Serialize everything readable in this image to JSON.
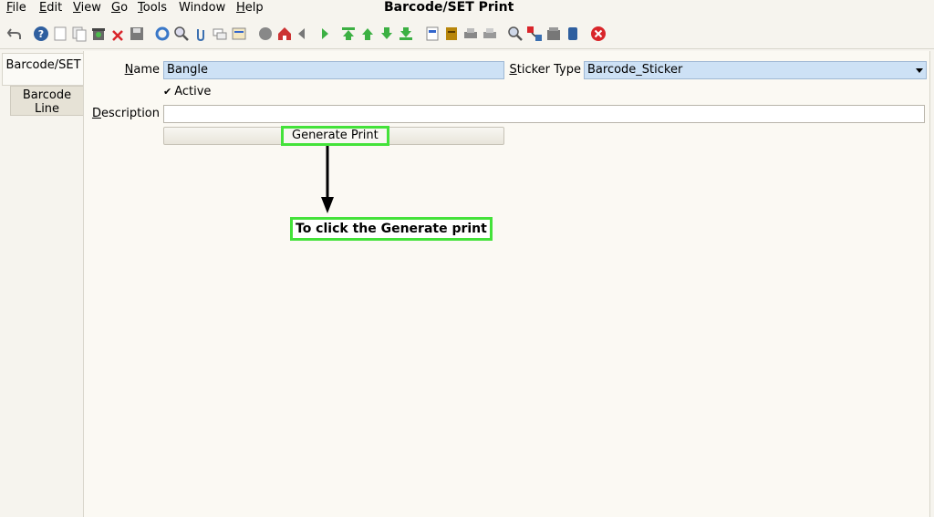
{
  "window": {
    "title": "Barcode/SET Print"
  },
  "menu": [
    {
      "key": "F",
      "rest": "ile"
    },
    {
      "key": "E",
      "rest": "dit"
    },
    {
      "key": "V",
      "rest": "iew"
    },
    {
      "key": "G",
      "rest": "o"
    },
    {
      "key": "T",
      "rest": "ools"
    },
    {
      "key": "",
      "rest": "Window"
    },
    {
      "key": "H",
      "rest": "elp"
    }
  ],
  "tabs": {
    "barcode_set": "Barcode/SET",
    "barcode_line_1": "Barcode",
    "barcode_line_2": "Line"
  },
  "form": {
    "name_label_key": "N",
    "name_label_rest": "ame",
    "name_value": "Bangle",
    "sticker_label_key": "S",
    "sticker_label_rest": "ticker Type",
    "sticker_value": "Barcode_Sticker",
    "active_check": "✔",
    "active_label": "Active",
    "description_label_key": "D",
    "description_label_rest": "escription",
    "description_value": "",
    "generate_button": "Generate Print"
  },
  "annotation": {
    "text": "To click the Generate print"
  },
  "colors": {
    "highlight": "#44e23a",
    "field_bg": "#cde1f5",
    "close": "#d9252a"
  },
  "toolbar_icons": [
    "undo-icon",
    "help-icon",
    "new-icon",
    "copy-icon",
    "delete-icon",
    "delete-selection-icon",
    "save-icon",
    "refresh-icon",
    "find-icon",
    "attachment-icon",
    "chat-icon",
    "history-icon",
    "report-icon",
    "home-icon",
    "back-icon",
    "forward-icon",
    "first-icon",
    "previous-icon",
    "next-icon",
    "last-icon",
    "detail-icon",
    "archive-icon",
    "print-icon",
    "print-preview-icon",
    "zoom-across-icon",
    "workflow-icon",
    "product-info-icon",
    "end-icon",
    "close-icon"
  ]
}
